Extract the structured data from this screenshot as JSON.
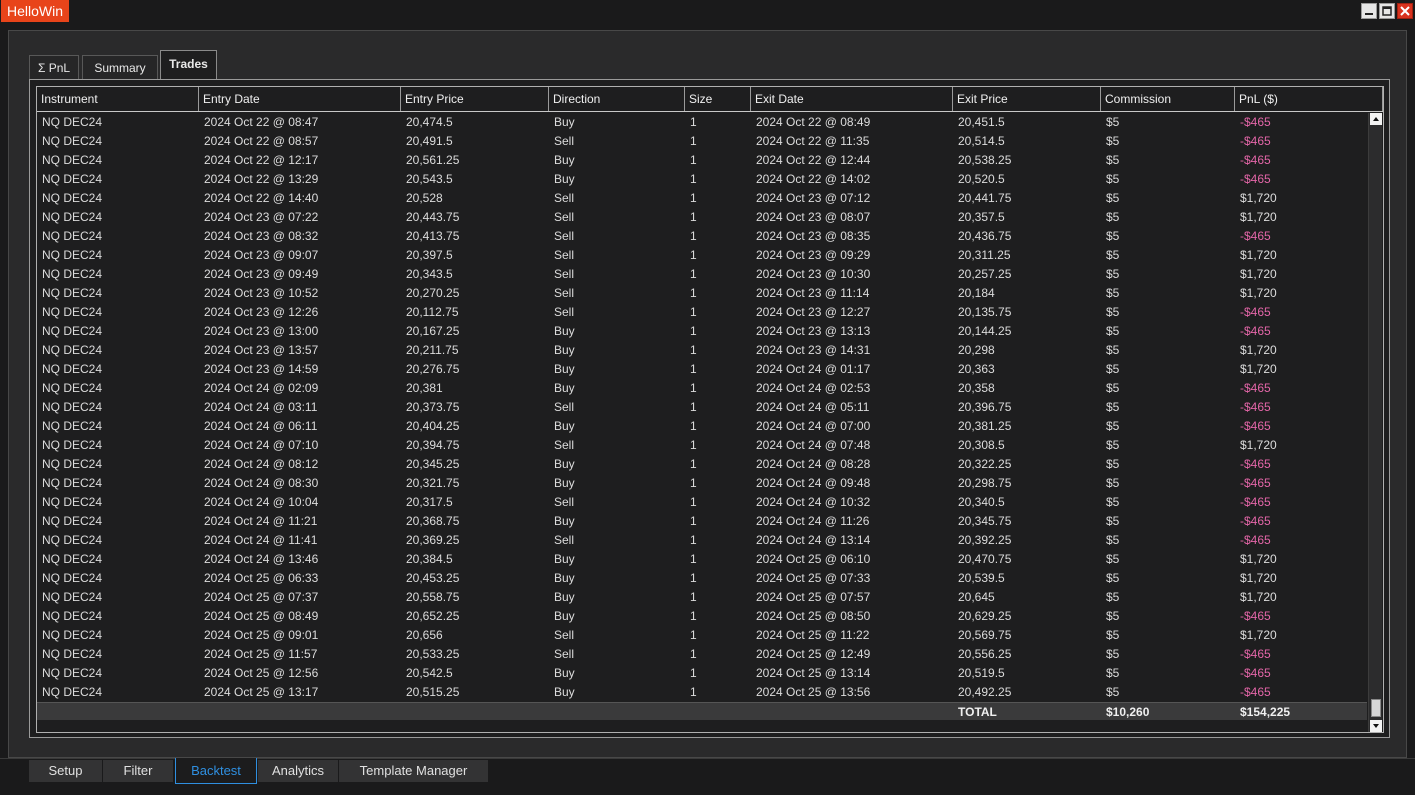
{
  "window": {
    "title": "HelloWin",
    "controls": {
      "minimize": "minimize-icon",
      "maximize": "maximize-icon",
      "close": "close-icon"
    }
  },
  "top_tabs": [
    {
      "label": "Σ PnL",
      "active": false
    },
    {
      "label": "Summary",
      "active": false
    },
    {
      "label": "Trades",
      "active": true
    }
  ],
  "table": {
    "columns": [
      "Instrument",
      "Entry Date",
      "Entry Price",
      "Direction",
      "Size",
      "Exit Date",
      "Exit Price",
      "Commission",
      "PnL ($)"
    ],
    "rows": [
      [
        "NQ DEC24",
        "2024 Oct 22 @ 08:47",
        "20,474.5",
        "Buy",
        "1",
        "2024 Oct 22 @ 08:49",
        "20,451.5",
        "$5",
        "-$465"
      ],
      [
        "NQ DEC24",
        "2024 Oct 22 @ 08:57",
        "20,491.5",
        "Sell",
        "1",
        "2024 Oct 22 @ 11:35",
        "20,514.5",
        "$5",
        "-$465"
      ],
      [
        "NQ DEC24",
        "2024 Oct 22 @ 12:17",
        "20,561.25",
        "Buy",
        "1",
        "2024 Oct 22 @ 12:44",
        "20,538.25",
        "$5",
        "-$465"
      ],
      [
        "NQ DEC24",
        "2024 Oct 22 @ 13:29",
        "20,543.5",
        "Buy",
        "1",
        "2024 Oct 22 @ 14:02",
        "20,520.5",
        "$5",
        "-$465"
      ],
      [
        "NQ DEC24",
        "2024 Oct 22 @ 14:40",
        "20,528",
        "Sell",
        "1",
        "2024 Oct 23 @ 07:12",
        "20,441.75",
        "$5",
        "$1,720"
      ],
      [
        "NQ DEC24",
        "2024 Oct 23 @ 07:22",
        "20,443.75",
        "Sell",
        "1",
        "2024 Oct 23 @ 08:07",
        "20,357.5",
        "$5",
        "$1,720"
      ],
      [
        "NQ DEC24",
        "2024 Oct 23 @ 08:32",
        "20,413.75",
        "Sell",
        "1",
        "2024 Oct 23 @ 08:35",
        "20,436.75",
        "$5",
        "-$465"
      ],
      [
        "NQ DEC24",
        "2024 Oct 23 @ 09:07",
        "20,397.5",
        "Sell",
        "1",
        "2024 Oct 23 @ 09:29",
        "20,311.25",
        "$5",
        "$1,720"
      ],
      [
        "NQ DEC24",
        "2024 Oct 23 @ 09:49",
        "20,343.5",
        "Sell",
        "1",
        "2024 Oct 23 @ 10:30",
        "20,257.25",
        "$5",
        "$1,720"
      ],
      [
        "NQ DEC24",
        "2024 Oct 23 @ 10:52",
        "20,270.25",
        "Sell",
        "1",
        "2024 Oct 23 @ 11:14",
        "20,184",
        "$5",
        "$1,720"
      ],
      [
        "NQ DEC24",
        "2024 Oct 23 @ 12:26",
        "20,112.75",
        "Sell",
        "1",
        "2024 Oct 23 @ 12:27",
        "20,135.75",
        "$5",
        "-$465"
      ],
      [
        "NQ DEC24",
        "2024 Oct 23 @ 13:00",
        "20,167.25",
        "Buy",
        "1",
        "2024 Oct 23 @ 13:13",
        "20,144.25",
        "$5",
        "-$465"
      ],
      [
        "NQ DEC24",
        "2024 Oct 23 @ 13:57",
        "20,211.75",
        "Buy",
        "1",
        "2024 Oct 23 @ 14:31",
        "20,298",
        "$5",
        "$1,720"
      ],
      [
        "NQ DEC24",
        "2024 Oct 23 @ 14:59",
        "20,276.75",
        "Buy",
        "1",
        "2024 Oct 24 @ 01:17",
        "20,363",
        "$5",
        "$1,720"
      ],
      [
        "NQ DEC24",
        "2024 Oct 24 @ 02:09",
        "20,381",
        "Buy",
        "1",
        "2024 Oct 24 @ 02:53",
        "20,358",
        "$5",
        "-$465"
      ],
      [
        "NQ DEC24",
        "2024 Oct 24 @ 03:11",
        "20,373.75",
        "Sell",
        "1",
        "2024 Oct 24 @ 05:11",
        "20,396.75",
        "$5",
        "-$465"
      ],
      [
        "NQ DEC24",
        "2024 Oct 24 @ 06:11",
        "20,404.25",
        "Buy",
        "1",
        "2024 Oct 24 @ 07:00",
        "20,381.25",
        "$5",
        "-$465"
      ],
      [
        "NQ DEC24",
        "2024 Oct 24 @ 07:10",
        "20,394.75",
        "Sell",
        "1",
        "2024 Oct 24 @ 07:48",
        "20,308.5",
        "$5",
        "$1,720"
      ],
      [
        "NQ DEC24",
        "2024 Oct 24 @ 08:12",
        "20,345.25",
        "Buy",
        "1",
        "2024 Oct 24 @ 08:28",
        "20,322.25",
        "$5",
        "-$465"
      ],
      [
        "NQ DEC24",
        "2024 Oct 24 @ 08:30",
        "20,321.75",
        "Buy",
        "1",
        "2024 Oct 24 @ 09:48",
        "20,298.75",
        "$5",
        "-$465"
      ],
      [
        "NQ DEC24",
        "2024 Oct 24 @ 10:04",
        "20,317.5",
        "Sell",
        "1",
        "2024 Oct 24 @ 10:32",
        "20,340.5",
        "$5",
        "-$465"
      ],
      [
        "NQ DEC24",
        "2024 Oct 24 @ 11:21",
        "20,368.75",
        "Buy",
        "1",
        "2024 Oct 24 @ 11:26",
        "20,345.75",
        "$5",
        "-$465"
      ],
      [
        "NQ DEC24",
        "2024 Oct 24 @ 11:41",
        "20,369.25",
        "Sell",
        "1",
        "2024 Oct 24 @ 13:14",
        "20,392.25",
        "$5",
        "-$465"
      ],
      [
        "NQ DEC24",
        "2024 Oct 24 @ 13:46",
        "20,384.5",
        "Buy",
        "1",
        "2024 Oct 25 @ 06:10",
        "20,470.75",
        "$5",
        "$1,720"
      ],
      [
        "NQ DEC24",
        "2024 Oct 25 @ 06:33",
        "20,453.25",
        "Buy",
        "1",
        "2024 Oct 25 @ 07:33",
        "20,539.5",
        "$5",
        "$1,720"
      ],
      [
        "NQ DEC24",
        "2024 Oct 25 @ 07:37",
        "20,558.75",
        "Buy",
        "1",
        "2024 Oct 25 @ 07:57",
        "20,645",
        "$5",
        "$1,720"
      ],
      [
        "NQ DEC24",
        "2024 Oct 25 @ 08:49",
        "20,652.25",
        "Buy",
        "1",
        "2024 Oct 25 @ 08:50",
        "20,629.25",
        "$5",
        "-$465"
      ],
      [
        "NQ DEC24",
        "2024 Oct 25 @ 09:01",
        "20,656",
        "Sell",
        "1",
        "2024 Oct 25 @ 11:22",
        "20,569.75",
        "$5",
        "$1,720"
      ],
      [
        "NQ DEC24",
        "2024 Oct 25 @ 11:57",
        "20,533.25",
        "Sell",
        "1",
        "2024 Oct 25 @ 12:49",
        "20,556.25",
        "$5",
        "-$465"
      ],
      [
        "NQ DEC24",
        "2024 Oct 25 @ 12:56",
        "20,542.5",
        "Buy",
        "1",
        "2024 Oct 25 @ 13:14",
        "20,519.5",
        "$5",
        "-$465"
      ],
      [
        "NQ DEC24",
        "2024 Oct 25 @ 13:17",
        "20,515.25",
        "Buy",
        "1",
        "2024 Oct 25 @ 13:56",
        "20,492.25",
        "$5",
        "-$465"
      ]
    ],
    "totals": {
      "label": "TOTAL",
      "commission": "$10,260",
      "pnl": "$154,225"
    },
    "colors": {
      "negative_pnl": "#e466a8",
      "text": "#dcdcdc"
    }
  },
  "bottom_tabs": [
    {
      "label": "Setup",
      "active": false
    },
    {
      "label": "Filter",
      "active": false
    },
    {
      "label": "Backtest",
      "active": true
    },
    {
      "label": "Analytics",
      "active": false
    },
    {
      "label": "Template Manager",
      "active": false
    }
  ],
  "accent_color": "#2f8fe0",
  "title_color": "#e8441a"
}
